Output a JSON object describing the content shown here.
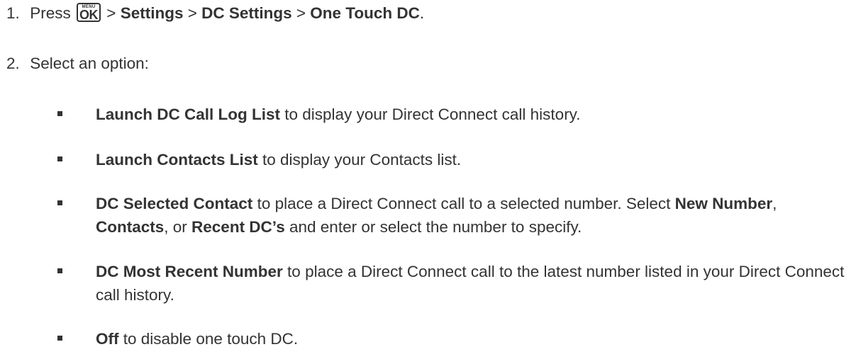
{
  "steps": [
    {
      "number": "1.",
      "prefix": "Press",
      "key_top": "MENU",
      "key_main": "OK",
      "sep1": " > ",
      "path1": "Settings",
      "sep2": " > ",
      "path2": "DC Settings",
      "sep3": " > ",
      "path3": "One Touch DC",
      "suffix": "."
    },
    {
      "number": "2.",
      "text": "Select an option:"
    }
  ],
  "options": [
    {
      "bold": "Launch DC Call Log List",
      "rest": " to display your Direct Connect call history."
    },
    {
      "bold": "Launch Contacts List",
      "rest": " to display your Contacts list."
    },
    {
      "bold": "DC Selected Contact",
      "rest": " to place a Direct Connect call to a selected number. Select ",
      "b2": "New Number",
      "r2": ", ",
      "b3": "Contacts",
      "r3": ", or ",
      "b4": "Recent DC’s",
      "r4": " and enter or select the number to specify."
    },
    {
      "bold": "DC Most Recent Number",
      "rest": " to place a Direct Connect call to the latest number listed in your Direct Connect call history."
    },
    {
      "bold": "Off",
      "rest": " to disable one touch DC."
    }
  ]
}
